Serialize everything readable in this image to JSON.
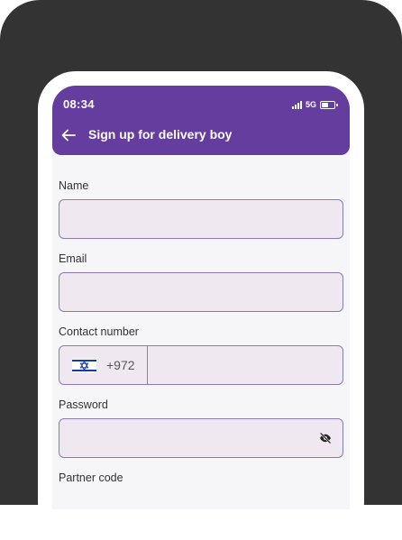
{
  "status_bar": {
    "time": "08:34",
    "network": "5G",
    "icons": [
      "signal-icon",
      "battery-icon"
    ]
  },
  "header": {
    "title": "Sign up for delivery boy",
    "back_icon": "arrow-left-icon"
  },
  "form": {
    "name": {
      "label": "Name",
      "value": "",
      "placeholder": ""
    },
    "email": {
      "label": "Email",
      "value": "",
      "placeholder": ""
    },
    "contact": {
      "label": "Contact number",
      "country_flag": "israel-flag-icon",
      "dial_code": "+972",
      "value": "",
      "placeholder": ""
    },
    "password": {
      "label": "Password",
      "value": "",
      "placeholder": "",
      "toggle_icon": "eye-off-icon"
    },
    "partner_code": {
      "label": "Partner code"
    }
  },
  "colors": {
    "header": "#653d9f",
    "input_background": "#efe8f0",
    "input_border": "#8a7bb6",
    "screen_background": "#f6f5f7",
    "frame": "#333333"
  }
}
